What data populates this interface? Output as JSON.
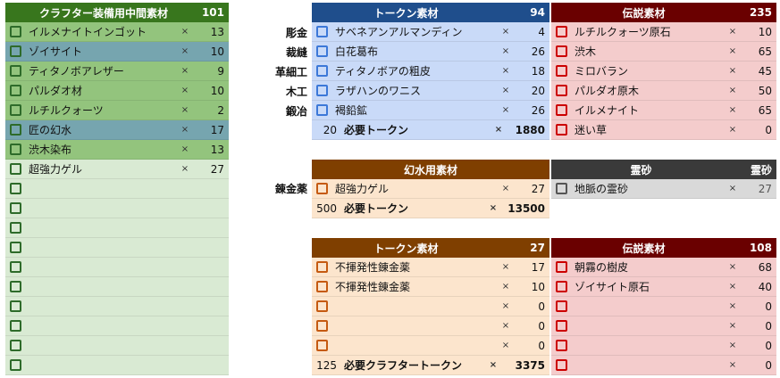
{
  "colors": {
    "green_header": "#38761d",
    "green_row": "#93c47d",
    "green_light": "#d9ead3",
    "teal_row": "#76a5af",
    "blue_header": "#1f4e8c",
    "blue_light": "#c9daf8",
    "red_header": "#6a0000",
    "red_light": "#f4cccc",
    "brown_header": "#7f3f00",
    "orange_light": "#fce5cd",
    "dark_header": "#3a3a3a",
    "gray_light": "#d9d9d9"
  },
  "left": {
    "title": "クラフター装備用中間素材",
    "count": "101",
    "items": [
      {
        "name": "イルメナイトインゴット",
        "x": "×",
        "qty": "13",
        "style": "green"
      },
      {
        "name": "ゾイサイト",
        "x": "×",
        "qty": "10",
        "style": "teal"
      },
      {
        "name": "ティタノボアレザー",
        "x": "×",
        "qty": "9",
        "style": "green"
      },
      {
        "name": "パルダオ材",
        "x": "×",
        "qty": "10",
        "style": "green"
      },
      {
        "name": "ルチルクォーツ",
        "x": "×",
        "qty": "2",
        "style": "green"
      },
      {
        "name": "匠の幻水",
        "x": "×",
        "qty": "17",
        "style": "teal"
      },
      {
        "name": "渋木染布",
        "x": "×",
        "qty": "13",
        "style": "green"
      },
      {
        "name": "超強力ゲル",
        "x": "×",
        "qty": "27",
        "style": "light"
      },
      {
        "name": "",
        "x": "",
        "qty": "",
        "style": "light"
      },
      {
        "name": "",
        "x": "",
        "qty": "",
        "style": "light"
      },
      {
        "name": "",
        "x": "",
        "qty": "",
        "style": "light"
      },
      {
        "name": "",
        "x": "",
        "qty": "",
        "style": "light"
      },
      {
        "name": "",
        "x": "",
        "qty": "",
        "style": "light"
      },
      {
        "name": "",
        "x": "",
        "qty": "",
        "style": "light"
      },
      {
        "name": "",
        "x": "",
        "qty": "",
        "style": "light"
      },
      {
        "name": "",
        "x": "",
        "qty": "",
        "style": "light"
      },
      {
        "name": "",
        "x": "",
        "qty": "",
        "style": "light"
      },
      {
        "name": "",
        "x": "",
        "qty": "",
        "style": "light"
      }
    ]
  },
  "token1": {
    "title": "トークン素材",
    "count": "94",
    "jobs": [
      "彫金",
      "裁縫",
      "革細工",
      "木工",
      "鍛冶"
    ],
    "items": [
      {
        "name": "サベネアンアルマンディン",
        "x": "×",
        "qty": "4"
      },
      {
        "name": "白花葛布",
        "x": "×",
        "qty": "26"
      },
      {
        "name": "ティタノボアの粗皮",
        "x": "×",
        "qty": "18"
      },
      {
        "name": "ラザハンのワニス",
        "x": "×",
        "qty": "20"
      },
      {
        "name": "褐鉛鉱",
        "x": "×",
        "qty": "26"
      }
    ],
    "summary": {
      "num": "20",
      "label": "必要トークン",
      "x": "×",
      "total": "1880"
    }
  },
  "legend1": {
    "title": "伝説素材",
    "count": "235",
    "items": [
      {
        "name": "ルチルクォーツ原石",
        "x": "×",
        "qty": "10"
      },
      {
        "name": "渋木",
        "x": "×",
        "qty": "65"
      },
      {
        "name": "ミロバラン",
        "x": "×",
        "qty": "45"
      },
      {
        "name": "パルダオ原木",
        "x": "×",
        "qty": "50"
      },
      {
        "name": "イルメナイト",
        "x": "×",
        "qty": "65"
      },
      {
        "name": "迷い草",
        "x": "×",
        "qty": "0"
      }
    ]
  },
  "gensui": {
    "title": "幻水用素材",
    "job": "錬金薬",
    "item": {
      "name": "超強力ゲル",
      "x": "×",
      "qty": "27"
    },
    "summary": {
      "num": "500",
      "label": "必要トークン",
      "x": "×",
      "total": "13500"
    }
  },
  "reisa": {
    "title": "霊砂",
    "count": "霊砂",
    "item": {
      "name": "地脈の霊砂",
      "x": "×",
      "qty": "27"
    }
  },
  "token2": {
    "title": "トークン素材",
    "count": "27",
    "items": [
      {
        "name": "不揮発性錬金薬",
        "x": "×",
        "qty": "17"
      },
      {
        "name": "不揮発性錬金薬",
        "x": "×",
        "qty": "10"
      },
      {
        "name": "",
        "x": "×",
        "qty": "0"
      },
      {
        "name": "",
        "x": "×",
        "qty": "0"
      },
      {
        "name": "",
        "x": "×",
        "qty": "0"
      }
    ],
    "summary": {
      "num": "125",
      "label": "必要クラフタートークン",
      "x": "×",
      "total": "3375"
    }
  },
  "legend2": {
    "title": "伝説素材",
    "count": "108",
    "items": [
      {
        "name": "朝霧の樹皮",
        "x": "×",
        "qty": "68"
      },
      {
        "name": "ゾイサイト原石",
        "x": "×",
        "qty": "40"
      },
      {
        "name": "",
        "x": "×",
        "qty": "0"
      },
      {
        "name": "",
        "x": "×",
        "qty": "0"
      },
      {
        "name": "",
        "x": "×",
        "qty": "0"
      },
      {
        "name": "",
        "x": "×",
        "qty": "0"
      }
    ]
  }
}
